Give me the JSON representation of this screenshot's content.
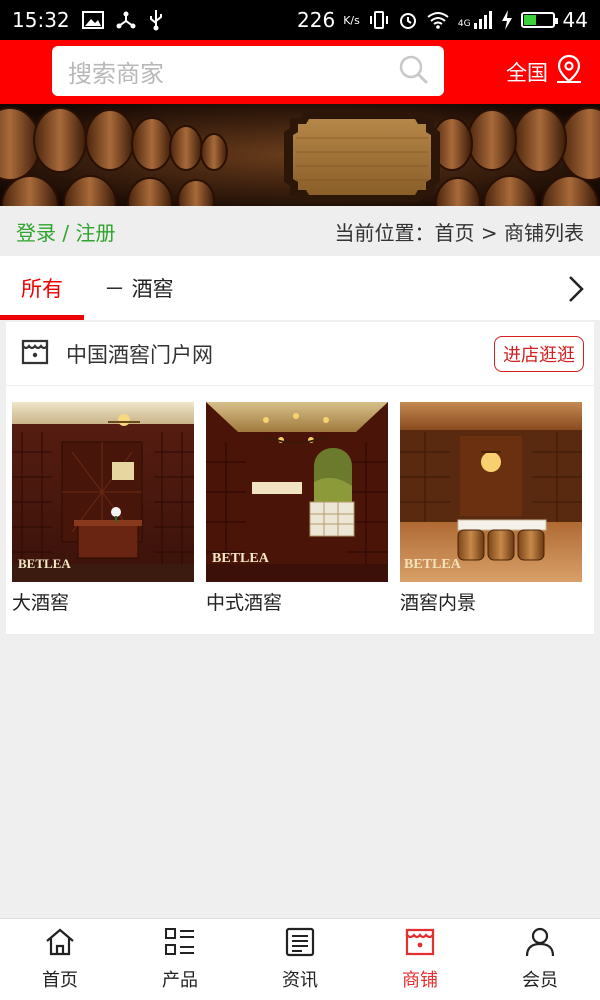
{
  "status_bar": {
    "time": "15:32",
    "net_speed": "226",
    "net_unit": "K/s",
    "signal": "4G",
    "battery": "44",
    "battery_level": 0.44
  },
  "header": {
    "search_placeholder": "搜索商家",
    "region_label": "全国"
  },
  "breadcrumb": {
    "login_register": "登录 / 注册",
    "location": "当前位置：首页 > 商铺列表"
  },
  "tabs": [
    {
      "label": "所有",
      "active": true
    },
    {
      "label": "－ 酒窖",
      "active": false
    }
  ],
  "shop": {
    "name": "中国酒窖门户网",
    "visit_label": "进店逛逛",
    "items": [
      {
        "label": "大酒窖",
        "watermark": "BETLEA"
      },
      {
        "label": "中式酒窖",
        "watermark": "BETLEA"
      },
      {
        "label": "酒窖内景",
        "watermark": "BETLEA"
      }
    ]
  },
  "bottom_nav": [
    {
      "label": "首页",
      "icon": "home-icon",
      "active": false
    },
    {
      "label": "产品",
      "icon": "grid-list-icon",
      "active": false
    },
    {
      "label": "资讯",
      "icon": "news-icon",
      "active": false
    },
    {
      "label": "商铺",
      "icon": "shop-icon",
      "active": true
    },
    {
      "label": "会员",
      "icon": "user-icon",
      "active": false
    }
  ],
  "colors": {
    "brand_red": "#ff0000",
    "accent_red": "#e00000",
    "login_green": "#2ea52e"
  }
}
